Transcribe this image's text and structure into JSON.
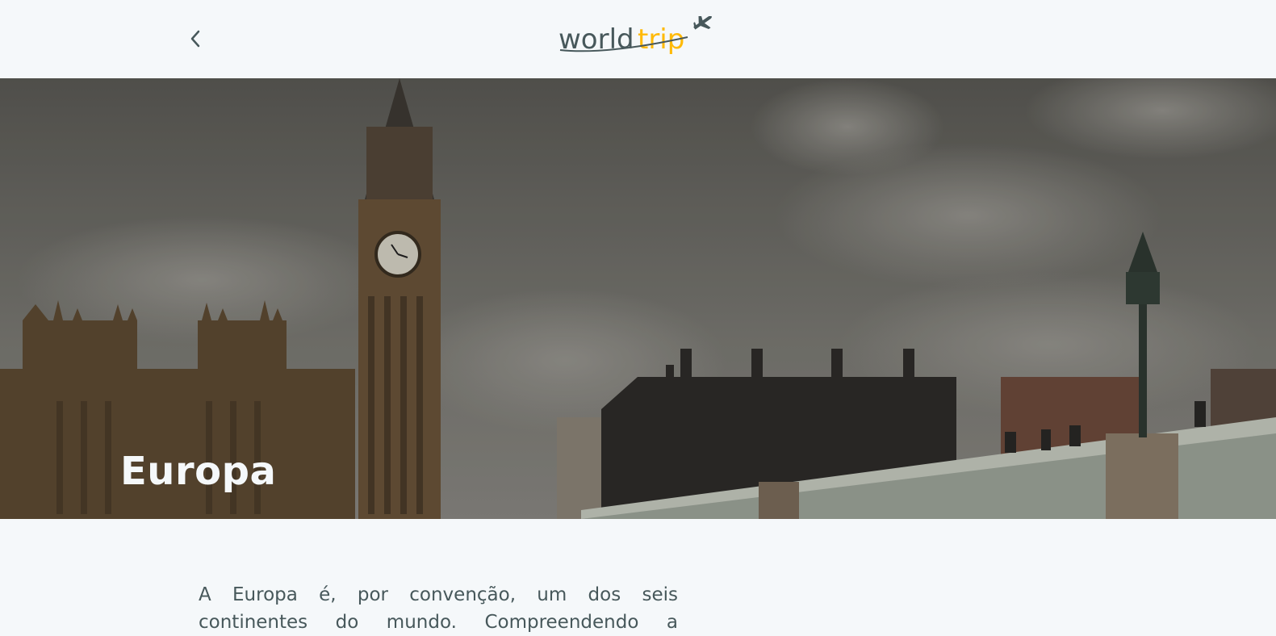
{
  "header": {
    "back_icon": "chevron-left-icon",
    "logo": {
      "word1": "world",
      "word2": "trip",
      "icon": "airplane-icon"
    }
  },
  "hero": {
    "title": "Europa"
  },
  "content": {
    "line1": "A Europa é, por convenção, um dos seis",
    "line2": "continentes do mundo. Compreendendo a"
  },
  "colors": {
    "background": "#f5f8fa",
    "heading": "#f5f8fa",
    "text": "#47585b",
    "accent": "#ffba08"
  }
}
